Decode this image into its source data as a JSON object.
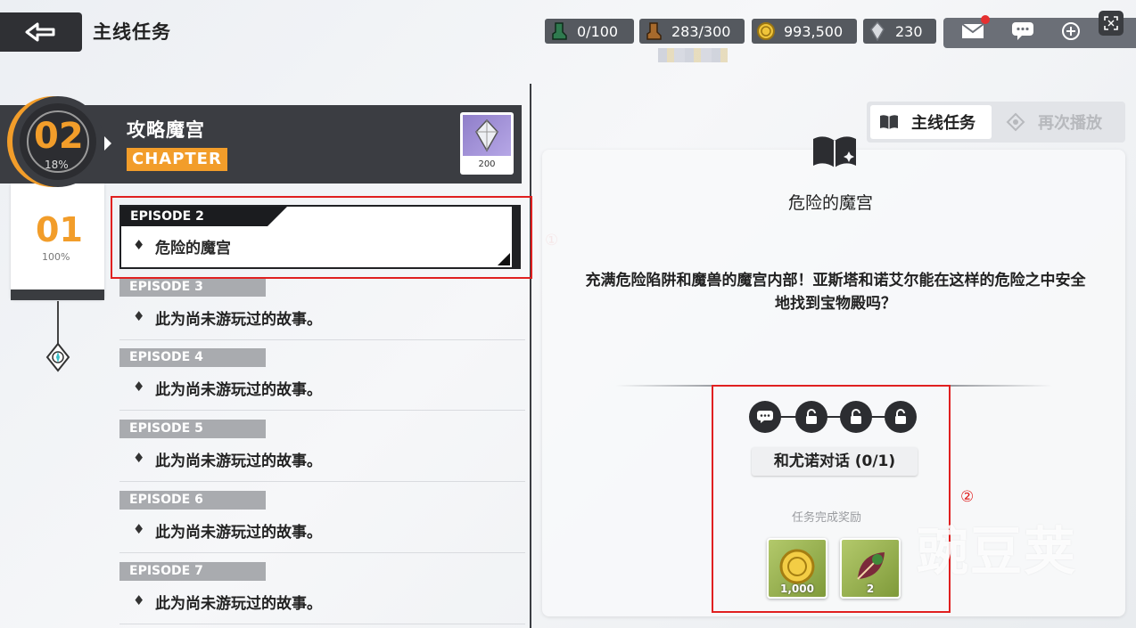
{
  "header": {
    "title": "主线任务"
  },
  "resources": [
    {
      "icon": "green-boot-icon",
      "value": "0/100"
    },
    {
      "icon": "brown-boot-icon",
      "value": "283/300"
    },
    {
      "icon": "gold-coin-icon",
      "value": "993,500"
    },
    {
      "icon": "crystal-icon",
      "value": "230"
    }
  ],
  "chapter": {
    "number": "02",
    "percent": "18%",
    "name": "攻略魔宫",
    "tag": "CHAPTER",
    "reward_count": "200"
  },
  "episode_progress": {
    "number": "01",
    "percent": "100%"
  },
  "episodes": [
    {
      "tag": "EPISODE 2",
      "title": "危险的魔宫",
      "active": true
    },
    {
      "tag": "EPISODE 3",
      "title": "此为尚未游玩过的故事。"
    },
    {
      "tag": "EPISODE 4",
      "title": "此为尚未游玩过的故事。"
    },
    {
      "tag": "EPISODE 5",
      "title": "此为尚未游玩过的故事。"
    },
    {
      "tag": "EPISODE 6",
      "title": "此为尚未游玩过的故事。"
    },
    {
      "tag": "EPISODE 7",
      "title": "此为尚未游玩过的故事。"
    }
  ],
  "annotations": {
    "marker1": "①",
    "marker2": "②"
  },
  "tabs": {
    "main": "主线任务",
    "replay": "再次播放"
  },
  "quest": {
    "title": "危险的魔宫",
    "description": "充满危险陷阱和魔兽的魔宫内部！亚斯塔和诺艾尔能在这样的危险之中安全地找到宝物殿吗？",
    "objective": "和尤诺对话 (0/1)",
    "reward_title": "任务完成奖励",
    "rewards": [
      {
        "icon": "gold-coin-icon",
        "count": "1,000"
      },
      {
        "icon": "leaf-item-icon",
        "count": "2"
      }
    ]
  },
  "watermark": "豌豆荚",
  "colors": {
    "accent": "#f29d2a",
    "dark": "#3b3d42",
    "annotation": "#e02020"
  }
}
